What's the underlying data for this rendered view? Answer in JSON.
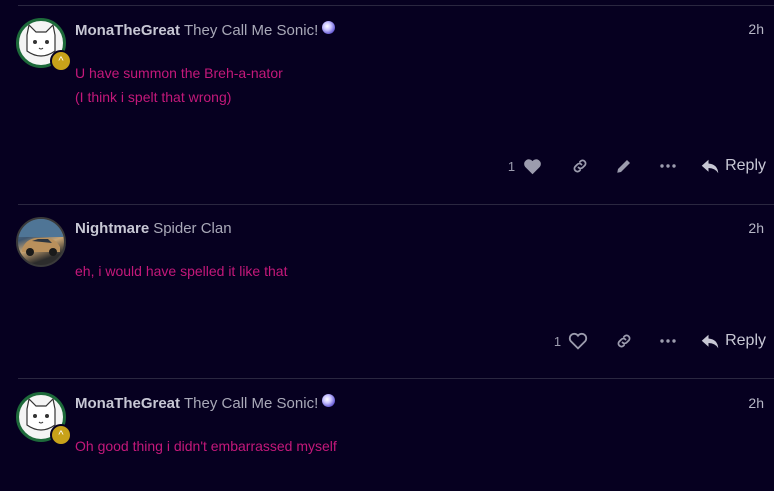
{
  "posts": [
    {
      "username": "MonaTheGreat",
      "user_title": "They Call Me Sonic!",
      "time": "2h",
      "body_lines": [
        "U have summon the Breh-a-nator",
        "(I think i spelt that wrong)"
      ],
      "like_count": "1",
      "liked": true,
      "reply_label": "Reply"
    },
    {
      "username": "Nightmare",
      "user_title": "Spider Clan",
      "time": "2h",
      "body_lines": [
        "eh, i would have spelled it like that"
      ],
      "like_count": "1",
      "liked": false,
      "reply_label": "Reply"
    },
    {
      "username": "MonaTheGreat",
      "user_title": "They Call Me Sonic!",
      "time": "2h",
      "body_lines": [
        "Oh good thing i didn't embarrassed myself"
      ]
    }
  ],
  "colors": {
    "background": "#060020",
    "post_text": "#c4187a",
    "badge": "#c8a21a"
  },
  "icons": [
    "heart-icon",
    "link-icon",
    "pencil-icon",
    "more-icon",
    "reply-icon",
    "chevron-up-icon"
  ]
}
